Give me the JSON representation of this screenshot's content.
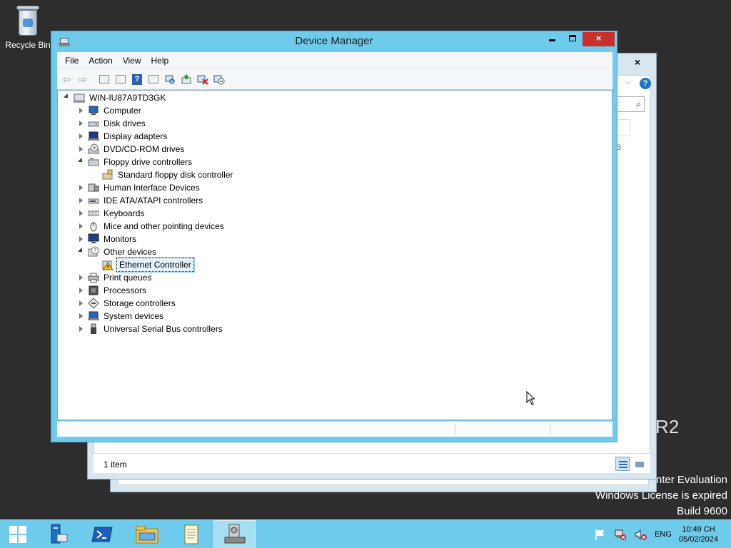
{
  "desktop": {
    "recycle_bin_label": "Recycle Bin",
    "watermark_lines": [
      "nter Evaluation",
      "Windows License is expired",
      "Build 9600"
    ],
    "edition_fragment": "R2"
  },
  "background_window": {
    "close_glyph": "×",
    "help_glyph": "?",
    "search_glyph": "⌕",
    "kb_fragment": "B",
    "status_text": "1 item"
  },
  "window": {
    "title": "Device Manager",
    "controls": {
      "minimize": "",
      "maximize": "",
      "close": "×"
    }
  },
  "menu": [
    "File",
    "Action",
    "View",
    "Help"
  ],
  "toolbar": [
    {
      "name": "back-button",
      "glyph": "⇦"
    },
    {
      "name": "forward-button",
      "glyph": "⇨"
    },
    {
      "name": "sep",
      "glyph": ""
    },
    {
      "name": "show-hide-console-tree-button",
      "glyph": ""
    },
    {
      "name": "properties-button",
      "glyph": ""
    },
    {
      "name": "help-button",
      "glyph": "?"
    },
    {
      "name": "action-pane-button",
      "glyph": ""
    },
    {
      "name": "scan-hardware-button",
      "glyph": ""
    },
    {
      "name": "update-driver-button",
      "glyph": ""
    },
    {
      "name": "uninstall-device-button",
      "glyph": ""
    },
    {
      "name": "disable-device-button",
      "glyph": ""
    }
  ],
  "tree": {
    "root": "WIN-IU87A9TD3GK",
    "nodes": [
      {
        "label": "Computer",
        "state": "collapsed",
        "icon": "computer-icon"
      },
      {
        "label": "Disk drives",
        "state": "collapsed",
        "icon": "disk-drive-icon"
      },
      {
        "label": "Display adapters",
        "state": "collapsed",
        "icon": "display-adapter-icon"
      },
      {
        "label": "DVD/CD-ROM drives",
        "state": "collapsed",
        "icon": "dvd-drive-icon"
      },
      {
        "label": "Floppy drive controllers",
        "state": "expanded",
        "icon": "floppy-controller-icon",
        "children": [
          {
            "label": "Standard floppy disk controller",
            "icon": "floppy-controller-icon",
            "selected": false
          }
        ]
      },
      {
        "label": "Human Interface Devices",
        "state": "collapsed",
        "icon": "hid-icon"
      },
      {
        "label": "IDE ATA/ATAPI controllers",
        "state": "collapsed",
        "icon": "ide-controller-icon"
      },
      {
        "label": "Keyboards",
        "state": "collapsed",
        "icon": "keyboard-icon"
      },
      {
        "label": "Mice and other pointing devices",
        "state": "collapsed",
        "icon": "mouse-icon"
      },
      {
        "label": "Monitors",
        "state": "collapsed",
        "icon": "monitor-icon"
      },
      {
        "label": "Other devices",
        "state": "expanded",
        "icon": "other-devices-icon",
        "children": [
          {
            "label": "Ethernet Controller",
            "icon": "unknown-device-warning-icon",
            "selected": true
          }
        ]
      },
      {
        "label": "Print queues",
        "state": "collapsed",
        "icon": "printer-icon"
      },
      {
        "label": "Processors",
        "state": "collapsed",
        "icon": "processor-icon"
      },
      {
        "label": "Storage controllers",
        "state": "collapsed",
        "icon": "storage-controller-icon"
      },
      {
        "label": "System devices",
        "state": "collapsed",
        "icon": "system-devices-icon"
      },
      {
        "label": "Universal Serial Bus controllers",
        "state": "collapsed",
        "icon": "usb-icon"
      }
    ]
  },
  "taskbar": {
    "items": [
      {
        "name": "start-button",
        "icon": "windows-logo-icon"
      },
      {
        "name": "server-manager-button",
        "icon": "server-manager-icon"
      },
      {
        "name": "powershell-button",
        "icon": "powershell-icon"
      },
      {
        "name": "file-explorer-button",
        "icon": "folder-icon"
      },
      {
        "name": "notepad-button",
        "icon": "notepad-icon"
      },
      {
        "name": "device-manager-taskbar-button",
        "icon": "device-manager-icon",
        "active": true
      }
    ],
    "tray": {
      "language": "ENG",
      "time": "10:49 CH",
      "date": "05/02/2024"
    }
  },
  "colors": {
    "window_frame": "#6ecbeb",
    "taskbar": "#6ecbeb",
    "desktop": "#2d2d2d",
    "close_button": "#c7312a",
    "selection": "#e5f1fb"
  }
}
